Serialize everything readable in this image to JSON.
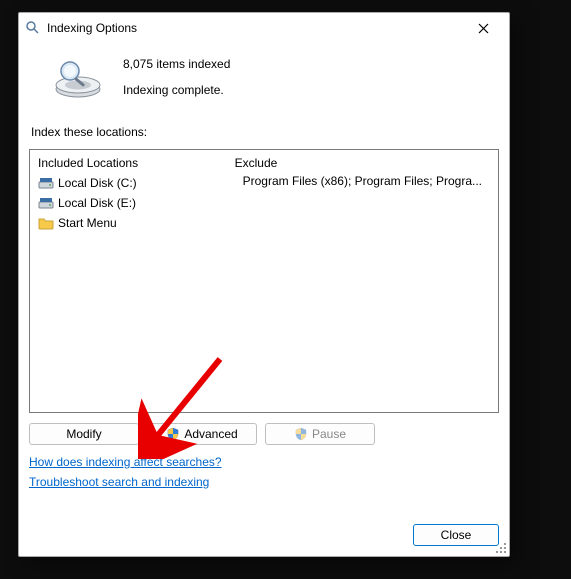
{
  "window": {
    "title": "Indexing Options"
  },
  "status": {
    "items_indexed": "8,075 items indexed",
    "state": "Indexing complete."
  },
  "section_label": "Index these locations:",
  "columns": {
    "included": "Included Locations",
    "exclude": "Exclude"
  },
  "locations": [
    {
      "name": "Local Disk (C:)",
      "exclude": "Program Files (x86); Program Files; Progra..."
    },
    {
      "name": "Local Disk (E:)",
      "exclude": ""
    },
    {
      "name": "Start Menu",
      "exclude": ""
    }
  ],
  "buttons": {
    "modify": "Modify",
    "advanced": "Advanced",
    "pause": "Pause",
    "close": "Close"
  },
  "links": {
    "how": "How does indexing affect searches?",
    "troubleshoot": "Troubleshoot search and indexing"
  },
  "icons": {
    "disk": "disk-icon",
    "folder": "folder-icon",
    "shield": "shield-icon",
    "magnifier": "magnifier-drive-icon",
    "close": "close-icon"
  }
}
